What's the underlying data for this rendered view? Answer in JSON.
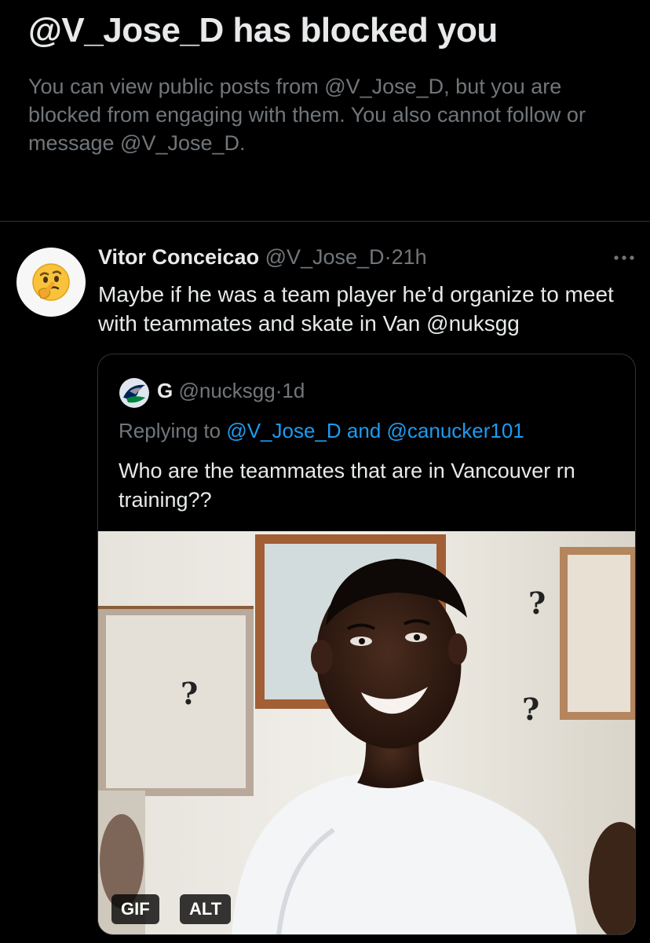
{
  "blocked": {
    "title": "@V_Jose_D has blocked you",
    "description": "You can view public posts from @V_Jose_D, but you are blocked from engaging with them. You also cannot follow or message @V_Jose_D."
  },
  "post": {
    "avatar_emoji": "thinking-face",
    "author_name": "Vitor Conceicao",
    "author_handle": "@V_Jose_D",
    "separator": "·",
    "time": "21h",
    "more_icon": "more-horizontal-icon",
    "text": "Maybe if he was a team player he’d organize to meet with teammates and skate in Van @nuksgg"
  },
  "quote": {
    "author_name": "G",
    "author_handle": "@nucksgg",
    "separator": "·",
    "time": "1d",
    "replying_prefix": "Replying to ",
    "replying_user1": "@V_Jose_D",
    "replying_and": " and ",
    "replying_user2": "@canucker101",
    "text": "Who are the teammates that are in Vancouver rn training??",
    "media": {
      "question_marks": [
        "?",
        "?",
        "?"
      ],
      "gif_label": "GIF",
      "alt_label": "ALT"
    }
  },
  "colors": {
    "background": "#000000",
    "primary_text": "#e7e9ea",
    "secondary_text": "#71767b",
    "link": "#1d9bf0",
    "border": "#2f3336"
  }
}
